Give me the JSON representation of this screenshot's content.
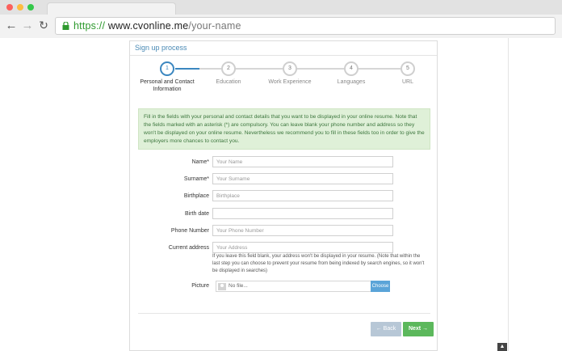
{
  "browser": {
    "url_protocol": "https://",
    "url_host": "www.cvonline.me",
    "url_path": "/your-name"
  },
  "panel": {
    "title": "Sign up process"
  },
  "steps": [
    {
      "number": "1",
      "label": "Personal and Contact Information",
      "active": true
    },
    {
      "number": "2",
      "label": "Education",
      "active": false
    },
    {
      "number": "3",
      "label": "Work Experience",
      "active": false
    },
    {
      "number": "4",
      "label": "Languages",
      "active": false
    },
    {
      "number": "5",
      "label": "URL",
      "active": false
    }
  ],
  "info_text": "Fill in the fields with your personal and contact details that you want to be displayed in your online resume. Note that the fields marked with an asterisk (*) are compulsory. You can leave blank your phone number and address so they won't be displayed on your online resume. Nevertheless we recommend you to fill in these fields too in order to give the employers more chances to contact you.",
  "form": {
    "name_label": "Name*",
    "name_placeholder": "Your Name",
    "surname_label": "Surname*",
    "surname_placeholder": "Your Surname",
    "birthplace_label": "Birthplace",
    "birthplace_placeholder": "Birthplace",
    "birthdate_label": "Birth date",
    "birthdate_placeholder": "",
    "phone_label": "Phone Number",
    "phone_placeholder": "Your Phone Number",
    "address_label": "Current address",
    "address_placeholder": "Your Address",
    "address_help": "If you leave this field blank, your address won't be displayed in your resume. (Note that within the last step you can choose to prevent your resume from being indexed by search engines, so it won't be displayed in searches)",
    "picture_label": "Picture",
    "file_text": "No file...",
    "choose_label": "Choose"
  },
  "buttons": {
    "back_label": "← Back",
    "next_label": "Next →"
  },
  "colors": {
    "accent": "#3b87c0",
    "success": "#5cb85c",
    "info_bg": "#dff0d8"
  }
}
